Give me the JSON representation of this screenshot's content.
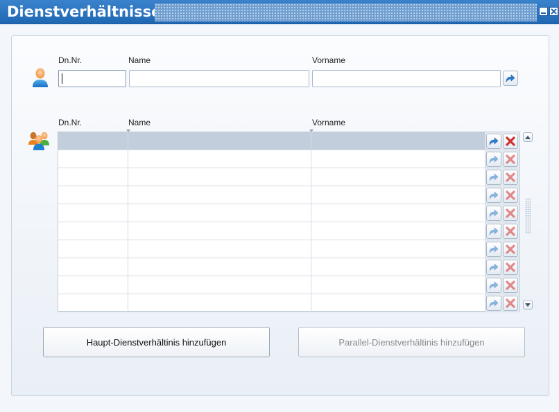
{
  "window": {
    "title": "Dienstverhältnisse"
  },
  "search": {
    "labels": {
      "dn_nr": "Dn.Nr.",
      "name": "Name",
      "vorname": "Vorname"
    },
    "values": {
      "dn_nr": "",
      "name": "",
      "vorname": ""
    }
  },
  "table": {
    "headers": {
      "dn_nr": "Dn.Nr.",
      "name": "Name",
      "vorname": "Vorname"
    },
    "rows": [
      {
        "dn_nr": "",
        "name": "",
        "vorname": ""
      },
      {
        "dn_nr": "",
        "name": "",
        "vorname": ""
      },
      {
        "dn_nr": "",
        "name": "",
        "vorname": ""
      },
      {
        "dn_nr": "",
        "name": "",
        "vorname": ""
      },
      {
        "dn_nr": "",
        "name": "",
        "vorname": ""
      },
      {
        "dn_nr": "",
        "name": "",
        "vorname": ""
      },
      {
        "dn_nr": "",
        "name": "",
        "vorname": ""
      },
      {
        "dn_nr": "",
        "name": "",
        "vorname": ""
      },
      {
        "dn_nr": "",
        "name": "",
        "vorname": ""
      },
      {
        "dn_nr": "",
        "name": "",
        "vorname": ""
      }
    ]
  },
  "actions": {
    "add_main": "Haupt-Dienstverhältinis hinzufügen",
    "add_parallel": "Parallel-Dienstverhältinis hinzufügen"
  },
  "icons": {
    "single_user": "user-icon",
    "group": "users-group-icon",
    "go": "arrow-forward-icon",
    "delete": "delete-x-icon"
  },
  "colors": {
    "titlebar": "#2a74c0",
    "selected_row": "#c3cedd",
    "delete_red": "#d0312d",
    "arrow_blue": "#2f7fd0"
  }
}
